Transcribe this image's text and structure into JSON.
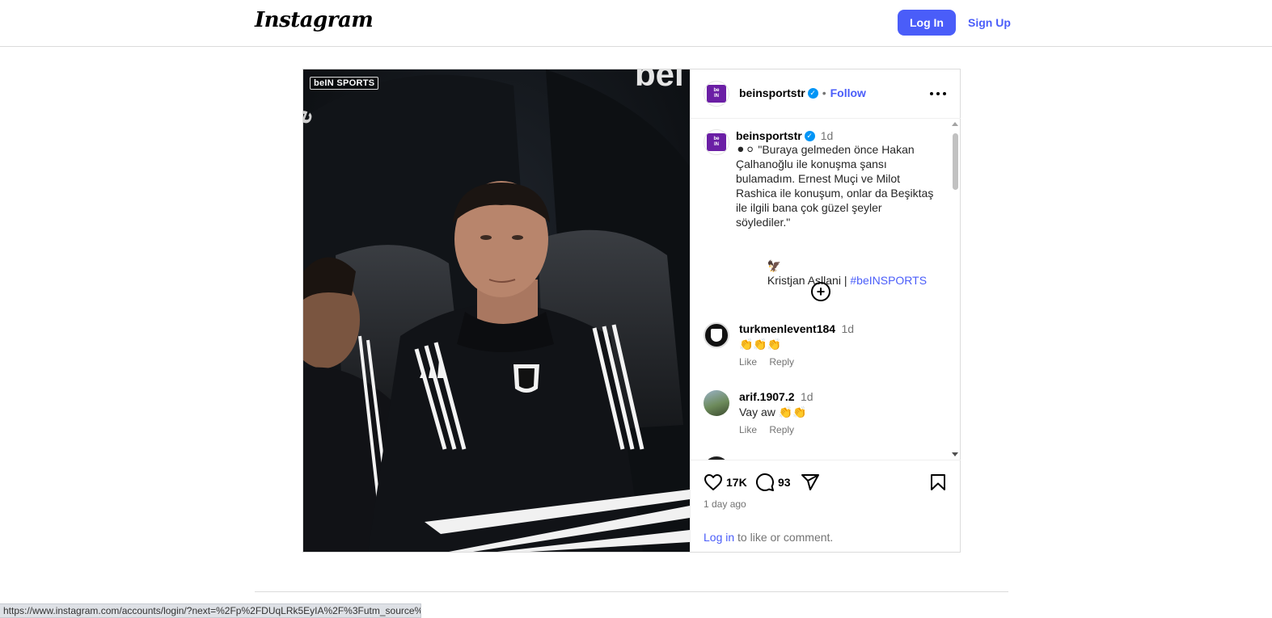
{
  "header": {
    "logo": "Instagram",
    "login_label": "Log In",
    "signup_label": "Sign Up"
  },
  "post": {
    "image_badge": "beIN SPORTS",
    "author": "beinsportstr",
    "follow_label": "Follow",
    "separator": "•",
    "caption": {
      "time": "1d",
      "text": "⚫⚪ \"Buraya gelmeden önce Hakan Çalhanoğlu ile konuşma şansı bulamadım. Ernest Muçi ve Milot Rashica ile konuşum, onlar da Beşiktaş ile ilgili bana çok güzel şeyler söylediler.\"",
      "attribution": "Kristjan Asllani | ",
      "hashtag": "#beINSPORTS"
    },
    "comments": [
      {
        "user": "turkmenlevent184",
        "time": "1d",
        "text": "👏👏👏",
        "like_label": "Like",
        "reply_label": "Reply"
      },
      {
        "user": "arif.1907.2",
        "time": "1d",
        "text": "Vay aw 👏👏",
        "like_label": "Like",
        "reply_label": "Reply"
      }
    ],
    "likes": "17K",
    "comment_count": "93",
    "timestamp": "1 day ago",
    "login_prompt": {
      "link": "Log in",
      "rest": " to like or comment."
    }
  },
  "status_bar": {
    "url": "https://www.instagram.com/accounts/login/?next=%2Fp%2FDUqLRk5EyIA%2F%3Futm_source%"
  },
  "colors": {
    "accent": "#4a5df9",
    "verified": "#0095f6",
    "brand_purple": "#6b1fa5"
  }
}
